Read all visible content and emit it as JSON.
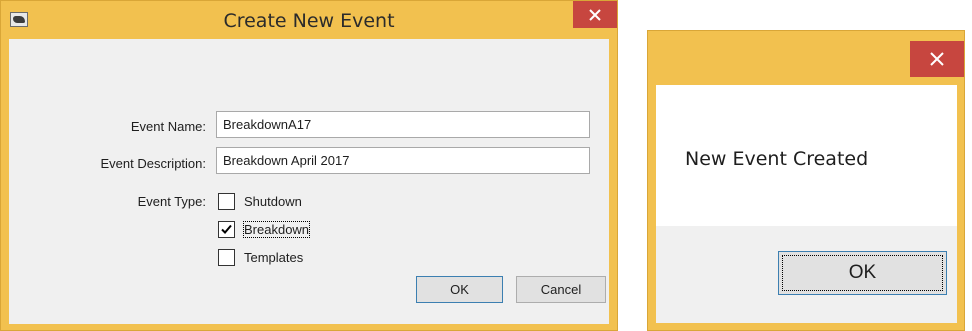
{
  "create_dialog": {
    "title": "Create New Event",
    "fields": {
      "event_name_label": "Event Name:",
      "event_name_value": "BreakdownA17",
      "event_description_label": "Event Description:",
      "event_description_value": "Breakdown April 2017",
      "event_type_label": "Event Type:"
    },
    "event_types": [
      {
        "label": "Shutdown",
        "checked": false
      },
      {
        "label": "Breakdown",
        "checked": true
      },
      {
        "label": "Templates",
        "checked": false
      }
    ],
    "ok_label": "OK",
    "cancel_label": "Cancel"
  },
  "message_dialog": {
    "message": "New Event Created",
    "ok_label": "OK"
  },
  "colors": {
    "frame": "#f2c14f",
    "close_button": "#c7463f",
    "client": "#f0f0f0"
  }
}
